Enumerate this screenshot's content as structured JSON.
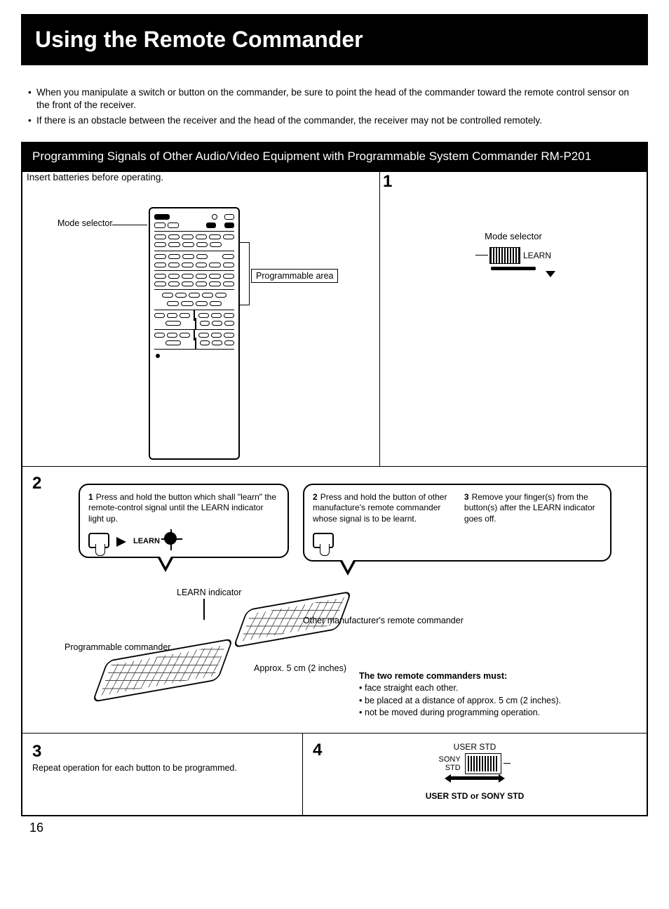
{
  "title": "Using the Remote Commander",
  "intro": {
    "b1": "When you manipulate a switch or button on the commander, be sure to point the head of the commander toward the remote control sensor on the front of the receiver.",
    "b2": "If there is an obstacle between the receiver and the head of the commander, the receiver may not be controlled remotely."
  },
  "section_header": "Programming Signals of Other Audio/Video Equipment with Programmable System Commander RM-P201",
  "panelA": {
    "insert": "Insert batteries before operating.",
    "mode_selector": "Mode selector",
    "programmable_area": "Programmable area"
  },
  "step1": {
    "num": "1",
    "mode_selector": "Mode selector",
    "learn": "LEARN"
  },
  "step2": {
    "num": "2",
    "c1": {
      "n": "1",
      "text": "Press and hold the button which shall \"learn\" the remote-control signal until the LEARN indicator light up.",
      "learn": "LEARN"
    },
    "c2a": {
      "n": "2",
      "text": "Press and hold the button of other manufacture's remote commander whose signal is to be learnt."
    },
    "c2b": {
      "n": "3",
      "text": "Remove your finger(s) from the button(s) after the LEARN indicator goes off."
    },
    "learn_indicator": "LEARN indicator",
    "prog_commander": "Programmable commander",
    "other_commander": "Other manufacturer's remote commander",
    "approx": "Approx. 5 cm (2 inches)",
    "must_title": "The two remote commanders must:",
    "must1": "face straight each other.",
    "must2": "be placed at a distance of approx. 5 cm (2 inches).",
    "must3": "not be moved during programming operation."
  },
  "step3": {
    "num": "3",
    "text": "Repeat operation for each button to be programmed."
  },
  "step4": {
    "num": "4",
    "user_std": "USER STD",
    "sony": "SONY",
    "std": "STD",
    "bottom": "USER STD or SONY STD"
  },
  "page_number": "16"
}
